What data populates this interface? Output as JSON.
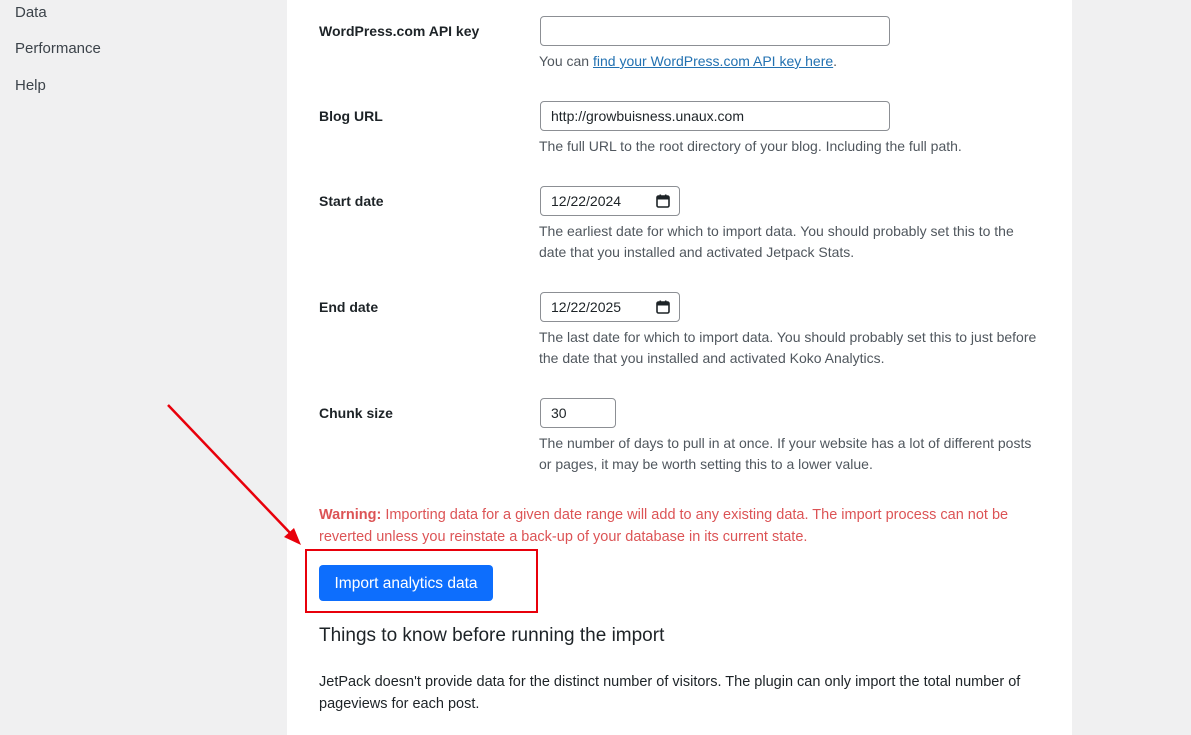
{
  "sidebar": {
    "items": [
      {
        "label": "Data"
      },
      {
        "label": "Performance"
      },
      {
        "label": "Help"
      }
    ]
  },
  "form": {
    "api_key": {
      "label": "WordPress.com API key",
      "value": "",
      "desc_prefix": "You can ",
      "desc_link": "find your WordPress.com API key here",
      "desc_suffix": "."
    },
    "blog_url": {
      "label": "Blog URL",
      "value": "http://growbuisness.unaux.com",
      "desc": "The full URL to the root directory of your blog. Including the full path."
    },
    "start_date": {
      "label": "Start date",
      "value": "12/22/2024",
      "desc": "The earliest date for which to import data. You should probably set this to the date that you installed and activated Jetpack Stats."
    },
    "end_date": {
      "label": "End date",
      "value": "12/22/2025",
      "desc": "The last date for which to import data. You should probably set this to just before the date that you installed and activated Koko Analytics."
    },
    "chunk_size": {
      "label": "Chunk size",
      "value": "30",
      "desc": "The number of days to pull in at once. If your website has a lot of different posts or pages, it may be worth setting this to a lower value."
    }
  },
  "warning": {
    "label": "Warning:",
    "text": " Importing data for a given date range will add to any existing data. The import process can not be reverted unless you reinstate a back-up of your database in its current state."
  },
  "import_button": "Import analytics data",
  "notes": {
    "title": "Things to know before running the import",
    "text": "JetPack doesn't provide data for the distinct number of visitors. The plugin can only import the total number of pageviews for each post."
  },
  "colors": {
    "accent": "#0d6efd",
    "warning": "#d63638",
    "annotation": "#e8000b",
    "link": "#2271b1"
  },
  "icons": {
    "date_picker": "calendar-icon"
  }
}
